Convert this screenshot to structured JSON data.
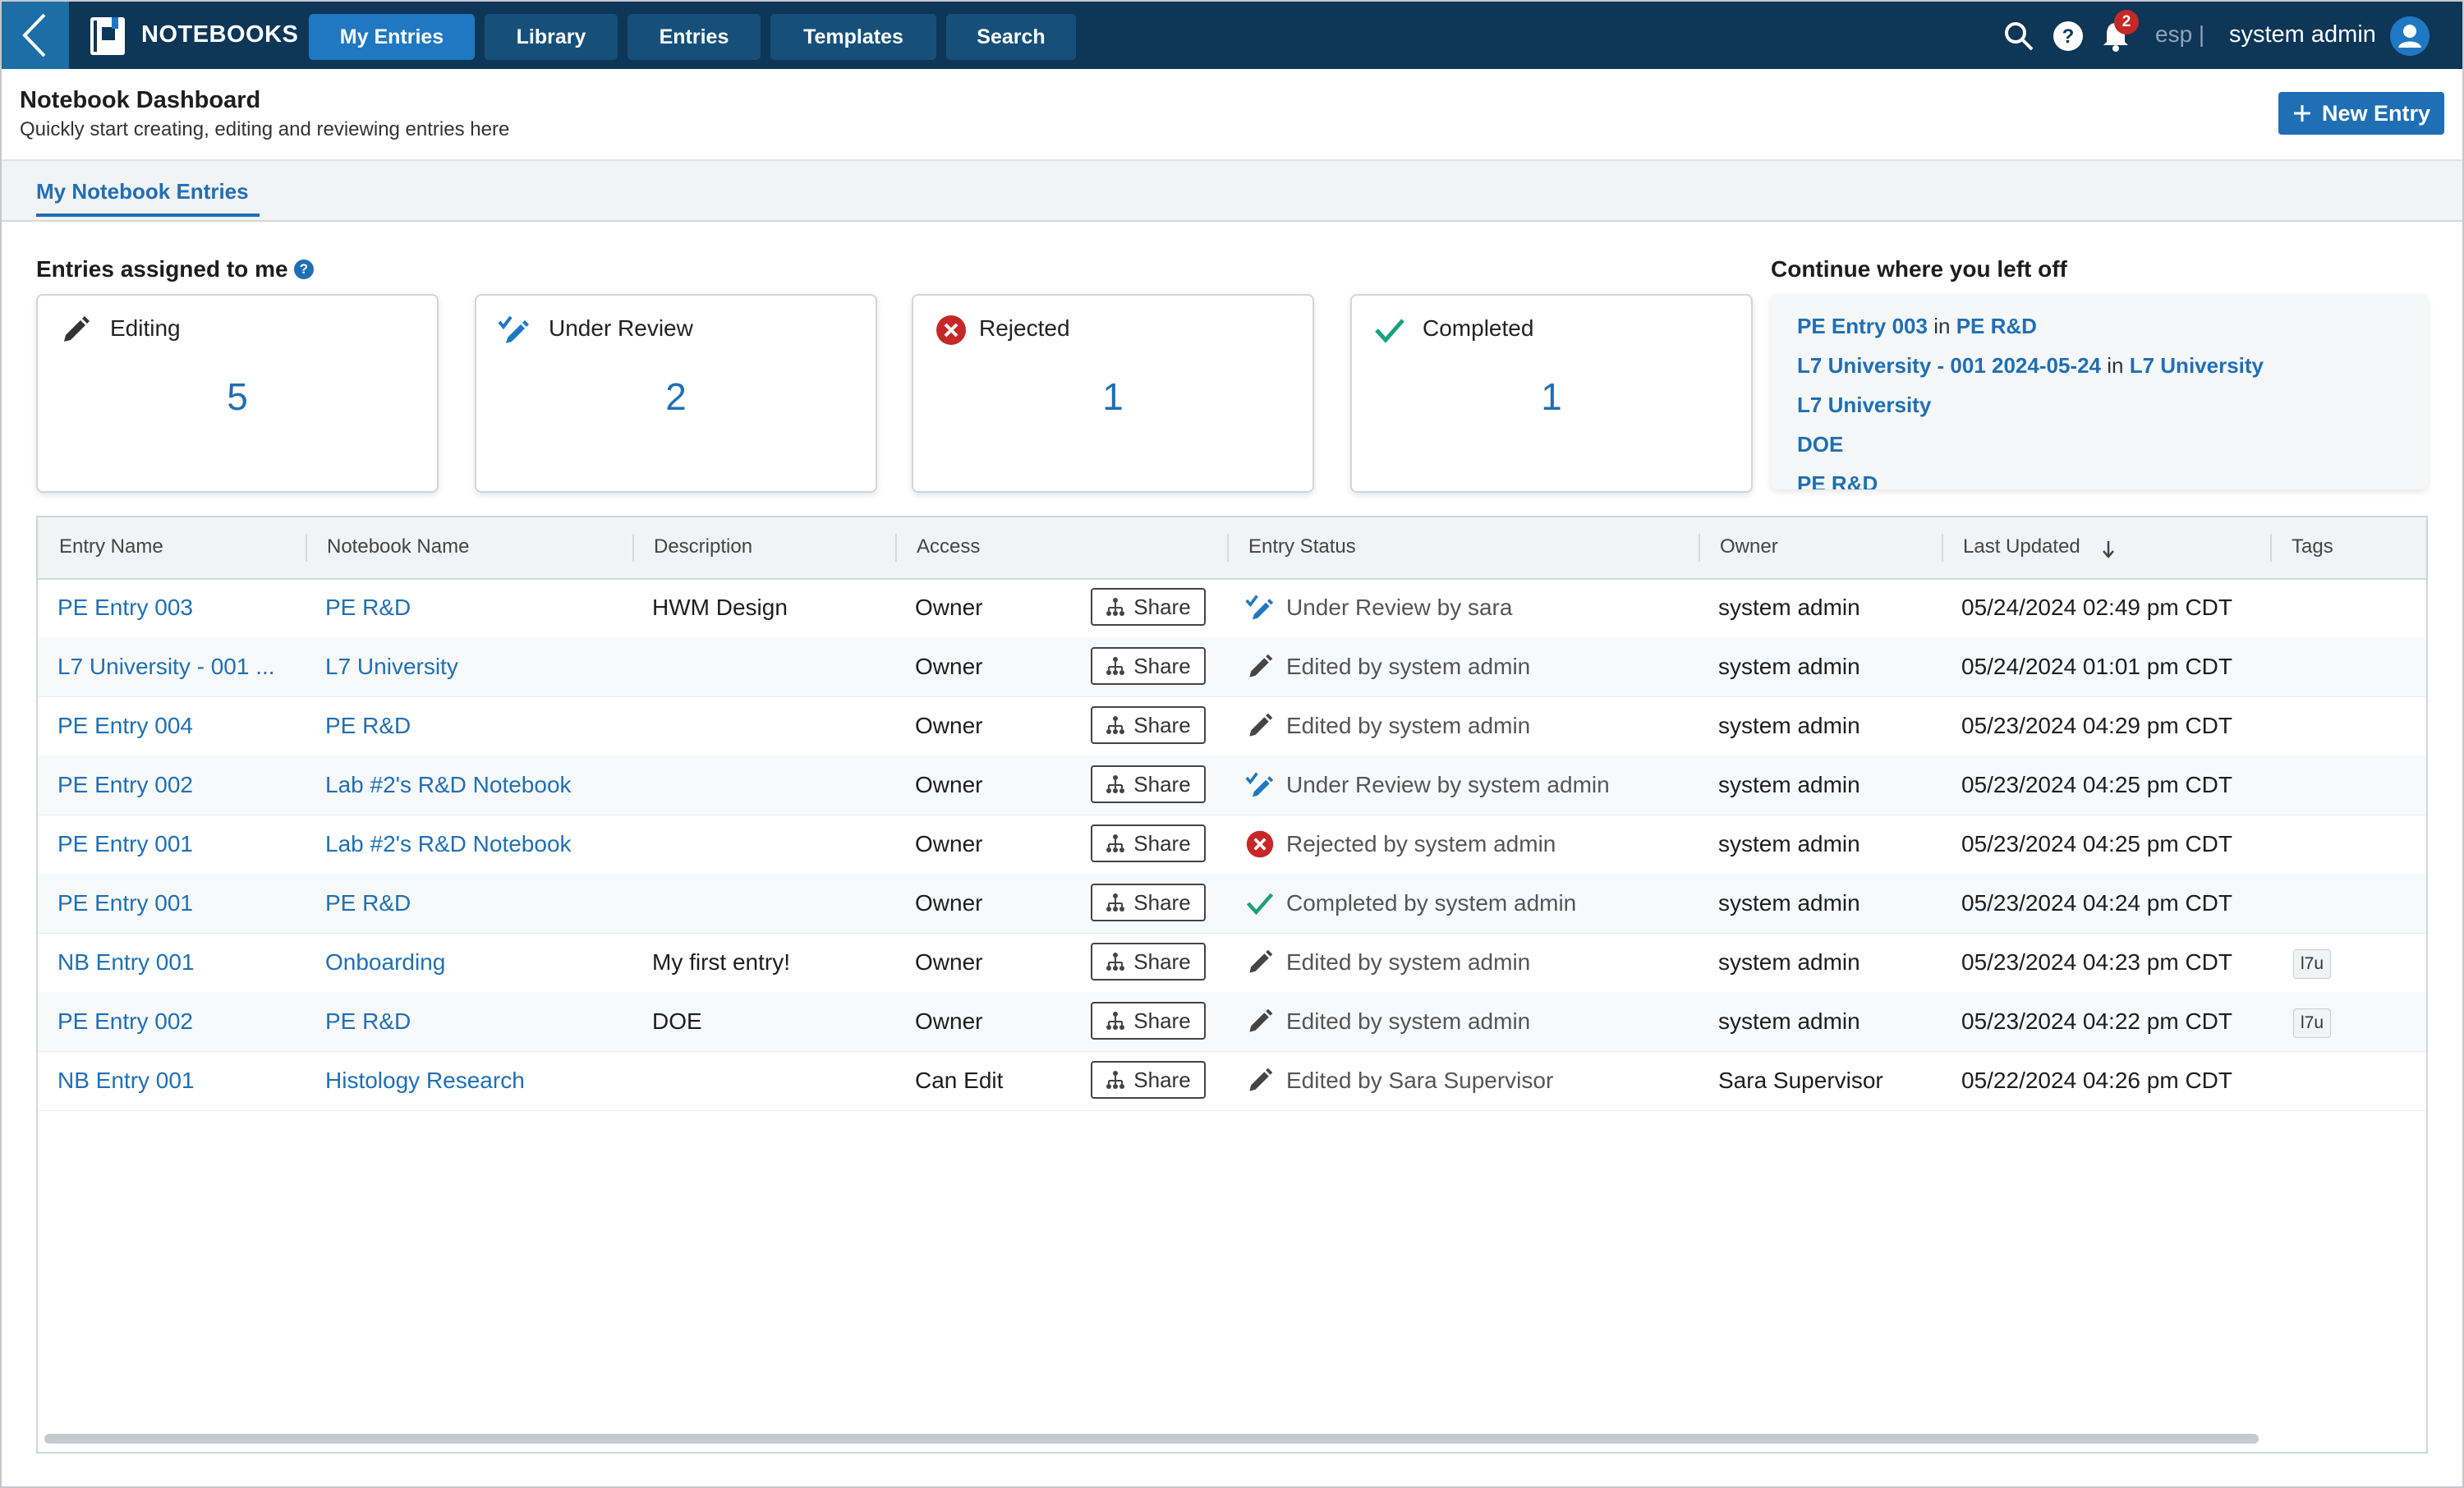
{
  "app": {
    "name": "NOTEBOOKS"
  },
  "nav": {
    "tabs": [
      "My Entries",
      "Library",
      "Entries",
      "Templates",
      "Search"
    ]
  },
  "topbar": {
    "notification_count": "2",
    "language": "esp |",
    "user": "system admin"
  },
  "header": {
    "title": "Notebook Dashboard",
    "subtitle": "Quickly start creating, editing and reviewing entries here",
    "new_entry_label": "New Entry"
  },
  "section_tab": "My Notebook Entries",
  "assigned": {
    "title": "Entries assigned to me",
    "help": "?",
    "cards": [
      {
        "label": "Editing",
        "count": "5",
        "icon": "pencil-icon"
      },
      {
        "label": "Under Review",
        "count": "2",
        "icon": "review-pencil-icon"
      },
      {
        "label": "Rejected",
        "count": "1",
        "icon": "rejected-icon"
      },
      {
        "label": "Completed",
        "count": "1",
        "icon": "check-icon"
      }
    ]
  },
  "continue": {
    "title": "Continue where you left off",
    "in_word": "in",
    "items": [
      {
        "entry": "PE Entry 003",
        "notebook": "PE R&D"
      },
      {
        "entry": "L7 University - 001 2024-05-24",
        "notebook": "L7 University"
      },
      {
        "entry": "L7 University",
        "notebook": ""
      },
      {
        "entry": "DOE",
        "notebook": ""
      },
      {
        "entry": "PE R&D",
        "notebook": ""
      }
    ]
  },
  "table": {
    "columns": [
      "Entry Name",
      "Notebook Name",
      "Description",
      "Access",
      "Entry Status",
      "Owner",
      "Last Updated",
      "Tags"
    ],
    "sort_icon": "arrow-down-icon",
    "share_label": "Share",
    "rows": [
      {
        "entry": "PE Entry 003",
        "notebook": "PE R&D",
        "description": "HWM Design",
        "access": "Owner",
        "status_icon": "review",
        "status": "Under Review by sara",
        "owner": "system admin",
        "updated": "05/24/2024 02:49 pm CDT",
        "tag": ""
      },
      {
        "entry": "L7 University - 001 ...",
        "notebook": "L7 University",
        "description": "",
        "access": "Owner",
        "status_icon": "edit",
        "status": "Edited by system admin",
        "owner": "system admin",
        "updated": "05/24/2024 01:01 pm CDT",
        "tag": ""
      },
      {
        "entry": "PE Entry 004",
        "notebook": "PE R&D",
        "description": "",
        "access": "Owner",
        "status_icon": "edit",
        "status": "Edited by system admin",
        "owner": "system admin",
        "updated": "05/23/2024 04:29 pm CDT",
        "tag": ""
      },
      {
        "entry": "PE Entry 002",
        "notebook": "Lab #2's R&D Notebook",
        "description": "",
        "access": "Owner",
        "status_icon": "review",
        "status": "Under Review by system admin",
        "owner": "system admin",
        "updated": "05/23/2024 04:25 pm CDT",
        "tag": ""
      },
      {
        "entry": "PE Entry 001",
        "notebook": "Lab #2's R&D Notebook",
        "description": "",
        "access": "Owner",
        "status_icon": "rejected",
        "status": "Rejected by system admin",
        "owner": "system admin",
        "updated": "05/23/2024 04:25 pm CDT",
        "tag": ""
      },
      {
        "entry": "PE Entry 001",
        "notebook": "PE R&D",
        "description": "",
        "access": "Owner",
        "status_icon": "completed",
        "status": "Completed by system admin",
        "owner": "system admin",
        "updated": "05/23/2024 04:24 pm CDT",
        "tag": ""
      },
      {
        "entry": "NB Entry 001",
        "notebook": "Onboarding",
        "description": "My first entry!",
        "access": "Owner",
        "status_icon": "edit",
        "status": "Edited by system admin",
        "owner": "system admin",
        "updated": "05/23/2024 04:23 pm CDT",
        "tag": "l7u"
      },
      {
        "entry": "PE Entry 002",
        "notebook": "PE R&D",
        "description": "DOE",
        "access": "Owner",
        "status_icon": "edit",
        "status": "Edited by system admin",
        "owner": "system admin",
        "updated": "05/23/2024 04:22 pm CDT",
        "tag": "l7u"
      },
      {
        "entry": "NB Entry 001",
        "notebook": "Histology Research",
        "description": "",
        "access": "Can Edit",
        "status_icon": "edit",
        "status": "Edited by Sara Supervisor",
        "owner": "Sara Supervisor",
        "updated": "05/22/2024 04:26 pm CDT",
        "tag": ""
      }
    ]
  },
  "colors": {
    "topbar": "#0d3657",
    "accent": "#1f6fb5",
    "active_tab": "#1f78c1",
    "rejected": "#c62828",
    "completed": "#1aa37a"
  }
}
